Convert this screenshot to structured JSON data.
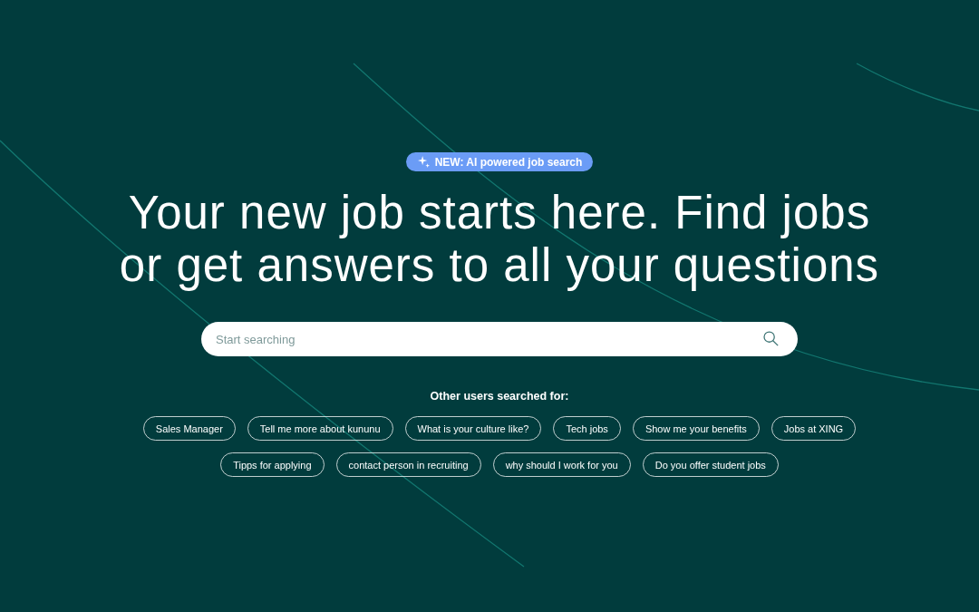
{
  "badge": {
    "text": "NEW: AI powered job search"
  },
  "headline": "Your new job starts here. Find jobs or get answers to all your questions",
  "search": {
    "placeholder": "Start searching"
  },
  "suggestions": {
    "label": "Other users searched for:",
    "items": [
      "Sales Manager",
      "Tell me more about kununu",
      "What is your culture like?",
      "Tech jobs",
      "Show me your benefits",
      "Jobs at XING",
      "Tipps for applying",
      "contact person in recruiting",
      "why should I work for you",
      "Do you offer student jobs"
    ]
  }
}
